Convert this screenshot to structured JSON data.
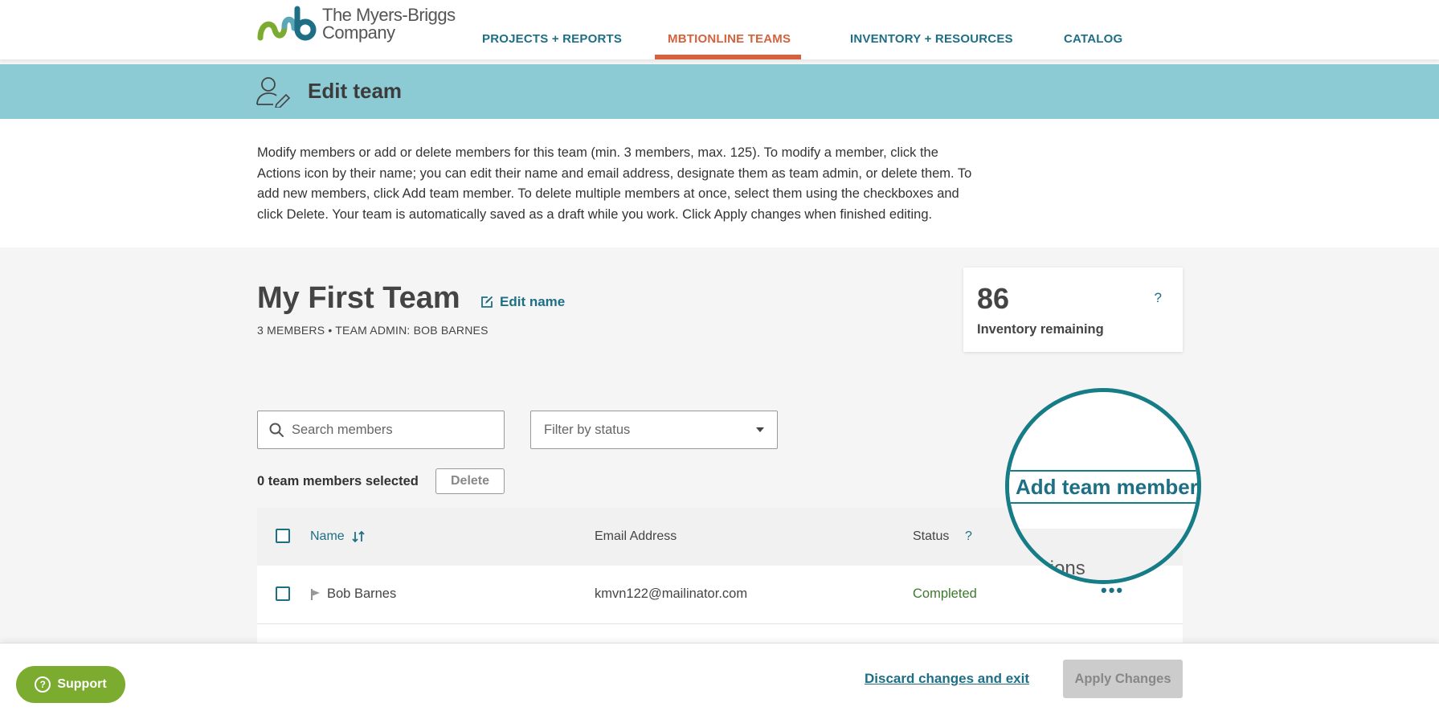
{
  "brand": {
    "name_line1": "The Myers-Briggs",
    "name_line2": "Company"
  },
  "nav": {
    "items": [
      {
        "label": "PROJECTS + REPORTS",
        "active": false
      },
      {
        "label": "MBTIONLINE TEAMS",
        "active": true
      },
      {
        "label": "INVENTORY + RESOURCES",
        "active": false
      },
      {
        "label": "CATALOG",
        "active": false
      }
    ]
  },
  "banner": {
    "title": "Edit team"
  },
  "intro": {
    "text": "Modify members or add or delete members for this team (min. 3 members, max. 125). To modify a member, click the Actions icon by their name; you can edit their name and email address, designate them as team admin, or delete them. To add new members, click Add team member. To delete multiple members at once, select them using the checkboxes and click Delete. Your team is automatically saved as a draft while you work. Click Apply changes when finished editing."
  },
  "team": {
    "name": "My First Team",
    "edit_name_label": "Edit name",
    "meta": "3 MEMBERS • TEAM ADMIN: BOB BARNES"
  },
  "inventory": {
    "count": "86",
    "label": "Inventory remaining",
    "help": "?"
  },
  "search": {
    "placeholder": "Search members"
  },
  "filter": {
    "placeholder": "Filter by status"
  },
  "selection": {
    "count_text": "0 team members selected",
    "delete_label": "Delete"
  },
  "table": {
    "headers": {
      "name": "Name",
      "email": "Email Address",
      "status": "Status",
      "status_help": "?",
      "actions": "Actions"
    },
    "rows": [
      {
        "name": "Bob Barnes",
        "email": "kmvn122@mailinator.com",
        "status": "Completed",
        "flag": true
      }
    ]
  },
  "magnifier": {
    "label": "Add team member",
    "partial_actions": "tions"
  },
  "footer": {
    "support_label": "Support",
    "discard_label": "Discard changes and exit",
    "apply_label": "Apply Changes"
  },
  "colors": {
    "accent": "#1e6f86",
    "active_nav": "#d4623c",
    "banner": "#8ccad4",
    "support": "#7bab2f",
    "status_completed": "#3c7a2e"
  }
}
